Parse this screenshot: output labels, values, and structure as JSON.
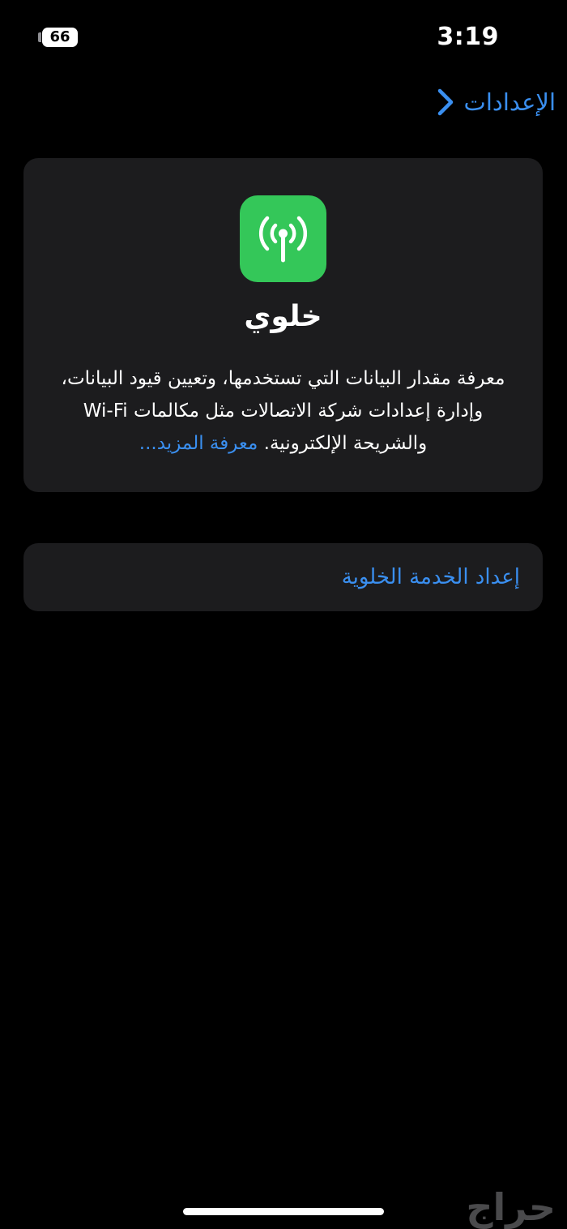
{
  "status_bar": {
    "time": "3:19",
    "battery_level": "66"
  },
  "nav": {
    "back_label": "الإعدادات",
    "back_icon": "chevron-right-icon"
  },
  "info_card": {
    "icon": "antenna-signal-icon",
    "icon_color": "#34c759",
    "title": "خلوي",
    "description": "معرفة مقدار البيانات التي تستخدمها، وتعيين قيود البيانات، وإدارة إعدادات شركة الاتصالات مثل مكالمات Wi-Fi والشريحة الإلكترونية. ",
    "learn_more": "معرفة المزيد..."
  },
  "setup": {
    "label": "إعداد الخدمة الخلوية"
  },
  "watermark": "حراج",
  "colors": {
    "accent": "#3a8ff0",
    "background": "#000000",
    "card": "#1c1c1e"
  }
}
